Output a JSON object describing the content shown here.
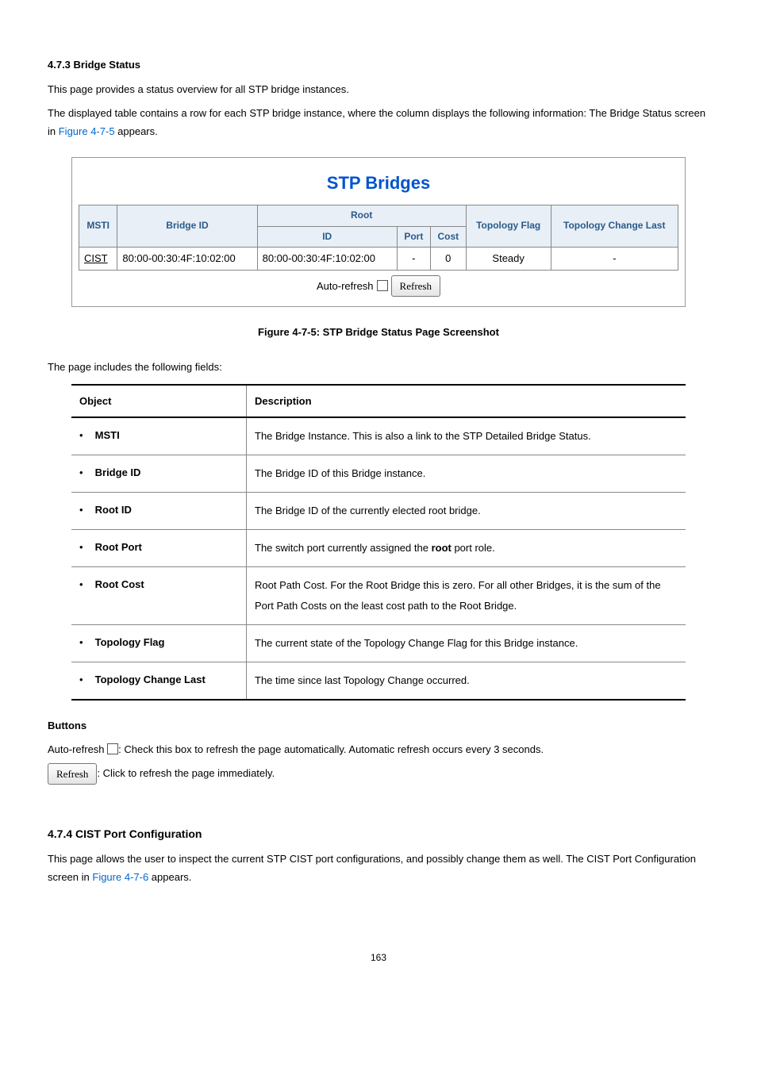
{
  "intro": {
    "heading": "4.7.3 Bridge Status",
    "p1": "This page provides a status overview for all STP bridge instances.",
    "p2a": "The displayed table contains a row for each STP bridge instance, where the column displays the following information: The Bridge Status screen in ",
    "p2link": "Figure 4-7-5",
    "p2b": " appears."
  },
  "figure": {
    "title": "STP Bridges",
    "headers": {
      "msti": "MSTI",
      "bridge_id": "Bridge ID",
      "root": "Root",
      "root_id": "ID",
      "root_port": "Port",
      "root_cost": "Cost",
      "topo_flag": "Topology Flag",
      "topo_change": "Topology Change Last"
    },
    "rows": [
      {
        "msti": "CIST",
        "bridge_id": "80:00-00:30:4F:10:02:00",
        "root_id": "80:00-00:30:4F:10:02:00",
        "root_port": "-",
        "root_cost": "0",
        "topo_flag": "Steady",
        "topo_change": "-"
      }
    ],
    "auto_refresh_label": "Auto-refresh",
    "refresh_btn": "Refresh",
    "caption_prefix": "Figure 4-7-5:",
    "caption": " STP Bridge Status Page Screenshot"
  },
  "fields_intro": "The page includes the following fields:",
  "fields_table": {
    "col_obj": "Object",
    "col_desc": "Description",
    "rows": [
      {
        "obj": "MSTI",
        "desc_pre": "The Bridge Instance. This is also a link to the STP Detailed Bridge Status.",
        "desc_strong": "",
        "desc_post": ""
      },
      {
        "obj": "Bridge ID",
        "desc_pre": "The Bridge ID of this Bridge instance.",
        "desc_strong": "",
        "desc_post": ""
      },
      {
        "obj": "Root ID",
        "desc_pre": "The Bridge ID of the currently elected root bridge.",
        "desc_strong": "",
        "desc_post": ""
      },
      {
        "obj": "Root Port",
        "desc_pre": "The switch port currently assigned the ",
        "desc_strong": "root",
        "desc_post": " port role."
      },
      {
        "obj": "Root Cost",
        "desc_pre": "Root Path Cost. For the Root Bridge this is zero. For all other Bridges, it is the sum of the Port Path Costs on the least cost path to the Root Bridge.",
        "desc_strong": "",
        "desc_post": ""
      },
      {
        "obj": "Topology Flag",
        "desc_pre": "The current state of the Topology Change Flag for this Bridge instance.",
        "desc_strong": "",
        "desc_post": ""
      },
      {
        "obj": "Topology Change Last",
        "desc_pre": "The time since last Topology Change occurred.",
        "desc_strong": "",
        "desc_post": ""
      }
    ]
  },
  "buttons": {
    "heading": "Buttons",
    "auto_a": "Auto-refresh ",
    "auto_b": ": Check this box to refresh the page automatically. Automatic refresh occurs every 3 seconds.",
    "refresh_btn": "Refresh",
    "refresh_desc": ": Click to refresh the page immediately."
  },
  "next": {
    "heading": "4.7.4 CIST Port Configuration",
    "p_a": "This page allows the user to inspect the current STP CIST port configurations, and possibly change them as well. The CIST Port Configuration screen in ",
    "p_link": "Figure 4-7-6",
    "p_b": " appears."
  },
  "page_number": "163"
}
